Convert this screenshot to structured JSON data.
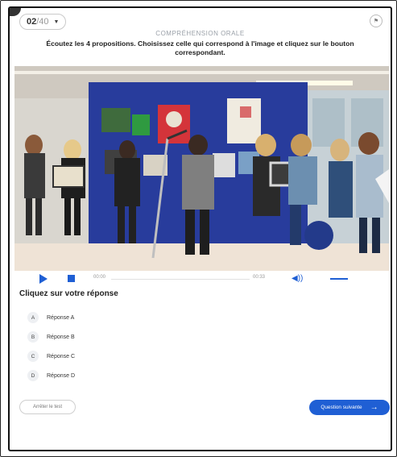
{
  "header": {
    "question_current": "02",
    "question_total": "/40",
    "chevron_icon": "chevron-down-icon",
    "flag_icon": "flag-icon"
  },
  "section_title": "COMPRÉHENSION ORALE",
  "instruction": "Écoutez les 4 propositions. Choisissez celle qui correspond à l'image et cliquez sur le bouton correspondant.",
  "player": {
    "time_start": "00:00",
    "time_end": "00:33",
    "play_icon": "play-icon",
    "stop_icon": "stop-icon",
    "volume_icon": "volume-icon",
    "accent": "#1f5fd4"
  },
  "question_label": "Cliquez sur votre réponse",
  "options": [
    {
      "letter": "A",
      "label": "Réponse A"
    },
    {
      "letter": "B",
      "label": "Réponse B"
    },
    {
      "letter": "C",
      "label": "Réponse C"
    },
    {
      "letter": "D",
      "label": "Réponse D"
    }
  ],
  "footer": {
    "stop_label": "Arrêter le test",
    "next_label": "Question suivante",
    "next_icon": "arrow-right-icon"
  }
}
